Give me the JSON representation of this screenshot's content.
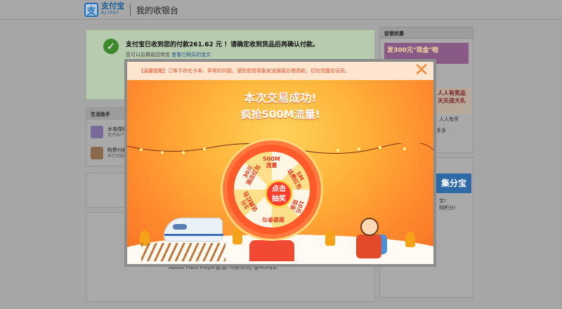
{
  "header": {
    "logo_cn": "支付宝",
    "logo_en": "ALIPAY",
    "logo_icon": "支",
    "title": "我的收银台"
  },
  "success": {
    "message": "支付宝已收到您的付款261.62 元 ！请确定收到货品后再确认付款。",
    "sub_prefix": "您可以后期返回淘宝",
    "sub_link": "查看已购买的宝贝"
  },
  "life_helper": {
    "title": "生活助手",
    "items": [
      {
        "title": "水电煤缴",
        "sub": "足不出户"
      },
      {
        "title": "购票付款",
        "sub": "异行付款"
      }
    ]
  },
  "flash_message": "Adobe Flash Player을(를) 사용하려면 클릭하세요.",
  "sidebar": {
    "promo_title": "促销优惠",
    "ad1": "发300元\"现金\"啦",
    "ad2_lines": [
      "人人有奖品",
      "天天送大礼"
    ],
    "ad2_sub": "人人有奖",
    "more": "多多",
    "ad3": "集分宝",
    "ad3_sub1": "宝!",
    "ad3_sub2": "购积分!"
  },
  "modal": {
    "notice": "【温馨提醒】订单不存在卡单、异常的问题，谨防假冒客服发送链接办理退款，切勿泄露验证码。",
    "close_glyph": "✕",
    "headline1": "本次交易成功!",
    "headline2": "疯抢500M流量!",
    "wheel": {
      "segments": [
        "500M\n流量",
        "5M\n话费红包",
        "10元\n现金",
        "谢谢参与",
        "5元\n话费红包",
        "30元\n酒店红包",
        "爆爆",
        "谢谢"
      ],
      "hub": "点击\n抽奖"
    }
  },
  "colors": {
    "overlay": "#a6a6a6",
    "accent_orange": "#ff8c2e",
    "notice_text": "#e14f2c",
    "wheel_red": "#ff5a2a"
  }
}
